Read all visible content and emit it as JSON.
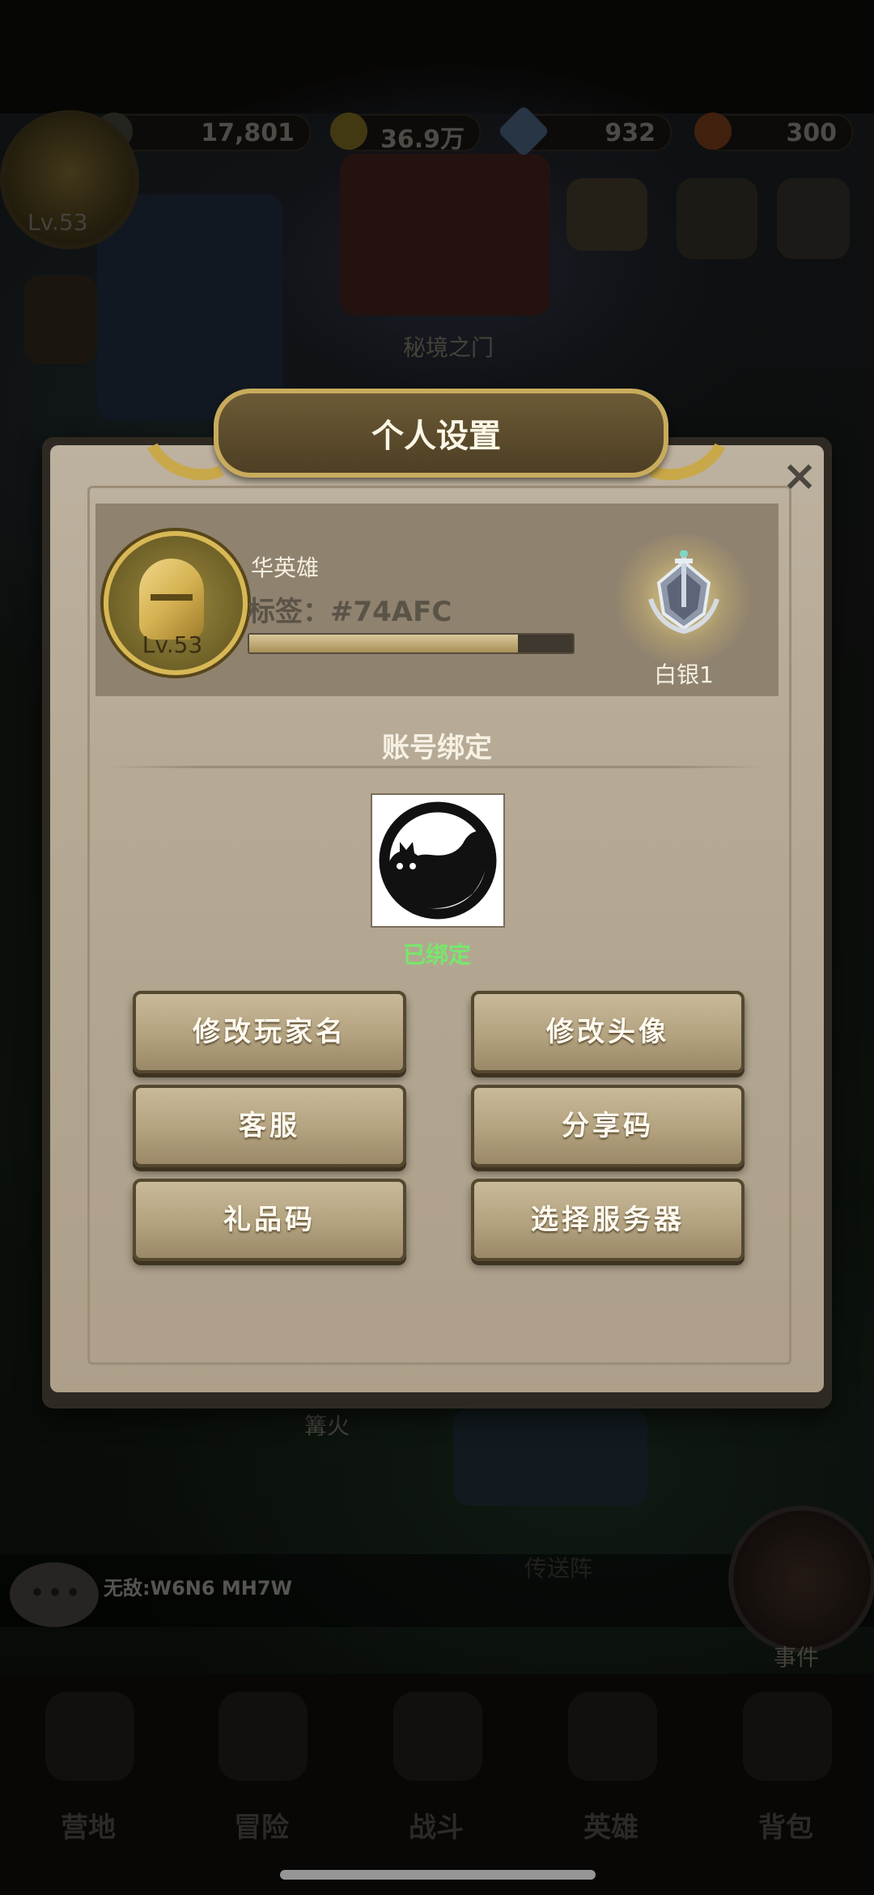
{
  "hud": {
    "resources": [
      {
        "name": "power",
        "value": "17,801",
        "icon": "crossed-swords-icon",
        "color": "#5b5a52"
      },
      {
        "name": "gold",
        "value": "36.9万",
        "icon": "gold-coin-icon",
        "color": "#8a7a2a"
      },
      {
        "name": "diamond",
        "value": "932",
        "icon": "diamond-icon",
        "color": "#5a7a9a"
      },
      {
        "name": "energy",
        "value": "300",
        "icon": "energy-orb-icon",
        "color": "#8a4a22"
      }
    ],
    "player_level": "Lv.53"
  },
  "scene": {
    "labels": {
      "secret_gate": "秘境之门",
      "bonfire": "篝火",
      "teleporter": "传送阵",
      "event": "事件"
    }
  },
  "chat": {
    "message": "无敌:W6N6 MH7W"
  },
  "navbar": {
    "items": [
      {
        "label": "营地",
        "icon": "camp-icon"
      },
      {
        "label": "冒险",
        "icon": "map-icon"
      },
      {
        "label": "战斗",
        "icon": "battle-icon"
      },
      {
        "label": "英雄",
        "icon": "hero-helmet-icon"
      },
      {
        "label": "背包",
        "icon": "bag-icon"
      }
    ]
  },
  "modal": {
    "title": "个人设置",
    "close_symbol": "×",
    "profile": {
      "name": "华英雄",
      "tag": "标签：#74AFC",
      "level": "Lv.53",
      "xp_progress": 0.83,
      "rank": "白银1"
    },
    "binding": {
      "title": "账号绑定",
      "status": "已绑定",
      "status_color": "#76e86b"
    },
    "buttons": [
      {
        "label": "修改玩家名"
      },
      {
        "label": "修改头像"
      },
      {
        "label": "客服"
      },
      {
        "label": "分享码"
      },
      {
        "label": "礼品码"
      },
      {
        "label": "选择服务器"
      }
    ]
  }
}
